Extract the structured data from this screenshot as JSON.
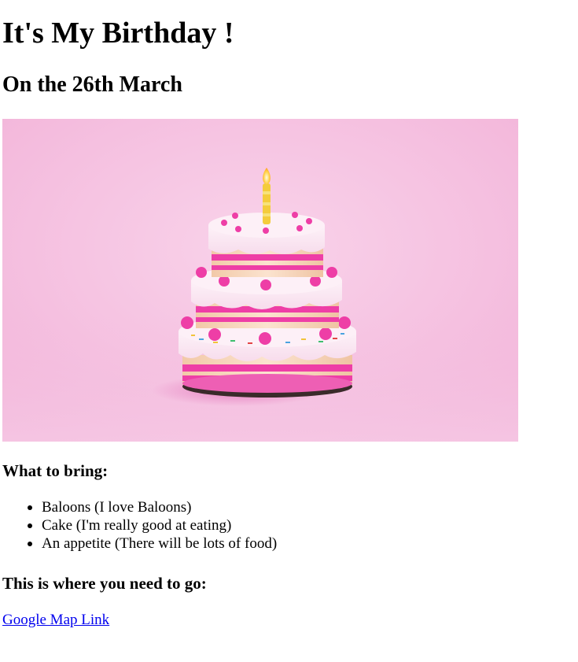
{
  "header": {
    "title": "It's My Birthday !",
    "subtitle": "On the 26th March"
  },
  "hero": {
    "image_description": "birthday-cake-image"
  },
  "bring": {
    "heading": "What to bring:",
    "items": [
      "Baloons (I love Baloons)",
      "Cake (I'm really good at eating)",
      "An appetite (There will be lots of food)"
    ]
  },
  "location": {
    "heading": "This is where you need to go:",
    "link_label": "Google Map Link"
  },
  "colors": {
    "link": "#0000ee",
    "background_pink": "#f6c6e3",
    "frosting_pink": "#ee3ea6"
  }
}
